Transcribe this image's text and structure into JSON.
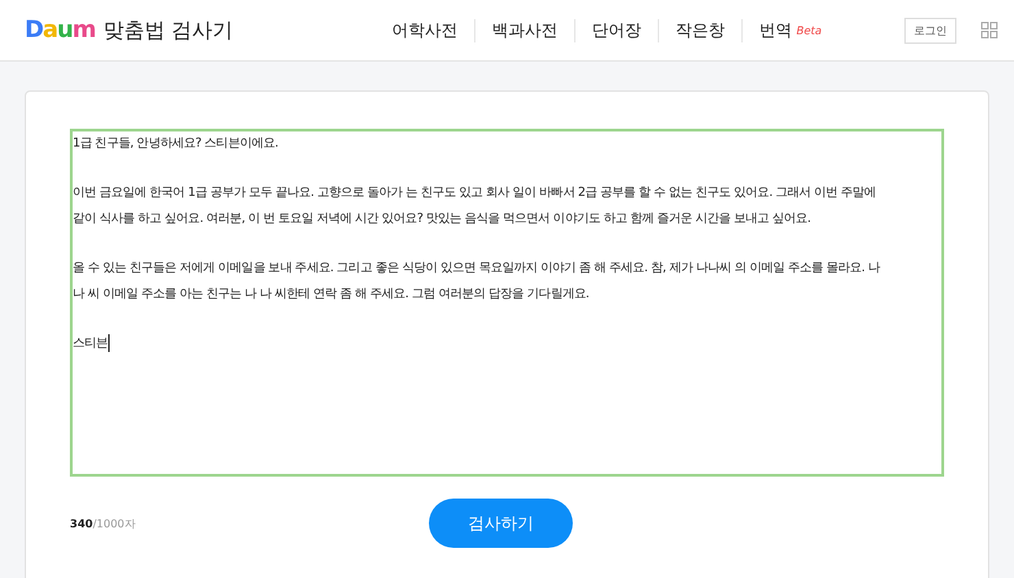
{
  "header": {
    "logo": "Daum",
    "title": "맞춤법 검사기",
    "nav": [
      {
        "label": "어학사전"
      },
      {
        "label": "백과사전"
      },
      {
        "label": "단어장"
      },
      {
        "label": "작은창"
      },
      {
        "label": "번역",
        "badge": "Beta"
      }
    ],
    "login": "로그인"
  },
  "editor": {
    "focused": true,
    "paragraphs": [
      [
        "1급 친구들, 안녕하세요? 스티븐이에요."
      ],
      [
        "이번 금요일에 한국어 1급 공부가 모두 끝나요. 고향으로 돌아가 는 친구도 있고 회사 일이 바빠서 2급 공부를 할 수 없는 친구도 있어요. 그래서 이번 주말에",
        "같이 식사를 하고 싶어요. 여러분, 이 번 토요일 저녁에 시간 있어요? 맛있는 음식을 먹으면서 이야기도 하고 함께 즐거운 시간을 보내고 싶어요."
      ],
      [
        "올 수 있는 친구들은 저에게 이메일을 보내 주세요. 그리고 좋은 식당이 있으면 목요일까지 이야기 좀 해 주세요. 참, 제가 나나씨 의 이메일 주소를 몰라요. 나",
        "나 씨 이메일 주소를 아는 친구는 나 나 씨한테 연락 좀 해 주세요. 그럼 여러분의 답장을 기다릴게요."
      ],
      [
        "스티븐"
      ]
    ],
    "counter": "**340**/1000자",
    "button": "검사하기"
  }
}
